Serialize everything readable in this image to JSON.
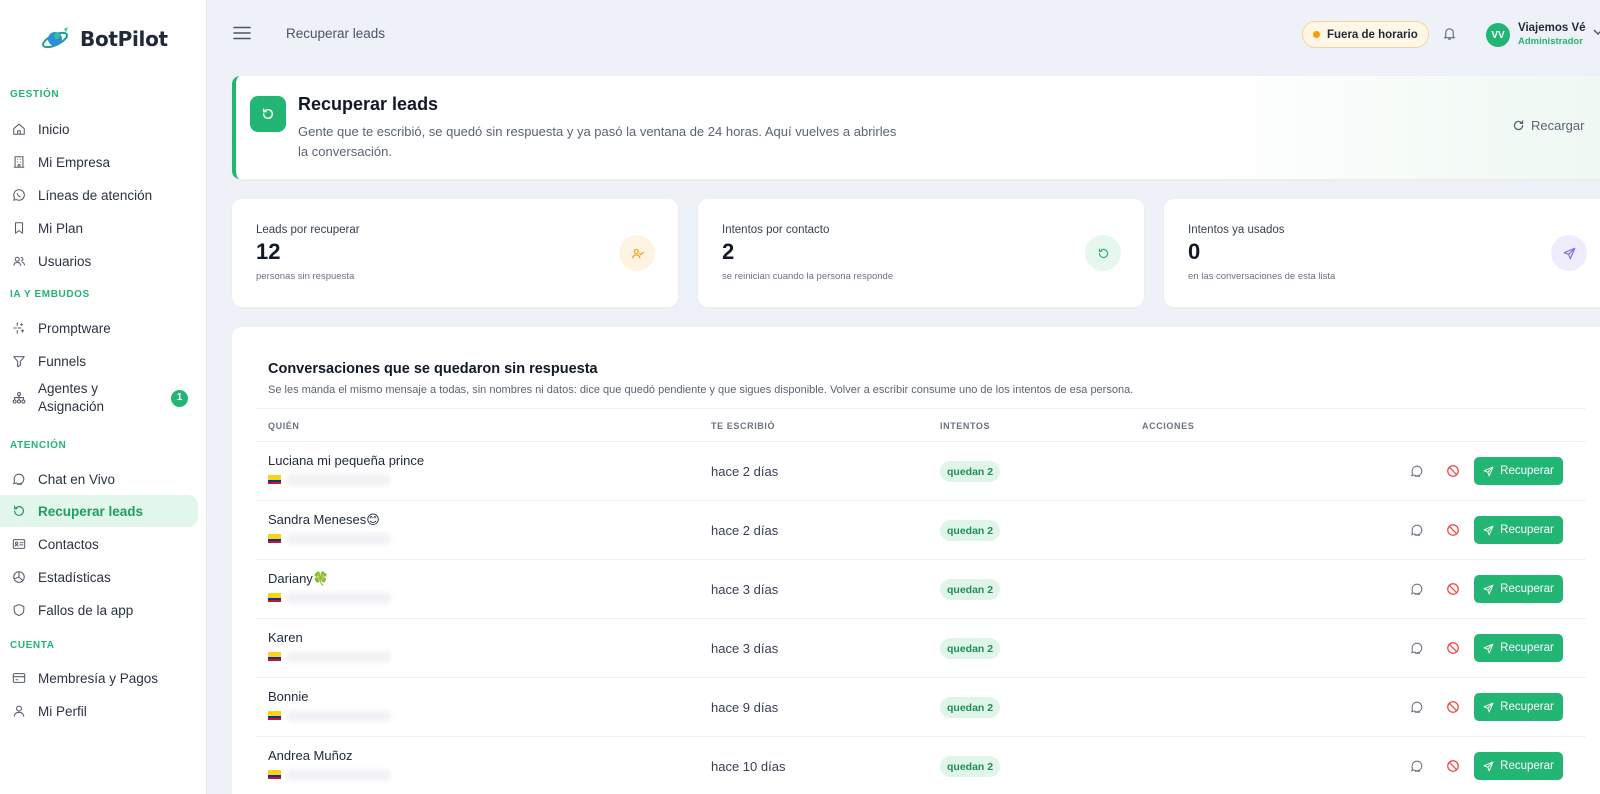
{
  "app": {
    "name": "BotPilot"
  },
  "sidebar": {
    "sections": [
      {
        "title": "GESTIÓN",
        "items": [
          {
            "label": "Inicio",
            "icon": "home-icon"
          },
          {
            "label": "Mi Empresa",
            "icon": "building-icon"
          },
          {
            "label": "Líneas de atención",
            "icon": "whatsapp-icon"
          },
          {
            "label": "Mi Plan",
            "icon": "bookmark-icon"
          },
          {
            "label": "Usuarios",
            "icon": "users-icon"
          }
        ]
      },
      {
        "title": "IA Y EMBUDOS",
        "items": [
          {
            "label": "Promptware",
            "icon": "sparkles-icon"
          },
          {
            "label": "Funnels",
            "icon": "funnel-icon"
          },
          {
            "label": "Agentes y Asignación",
            "icon": "network-icon",
            "badge": "1"
          }
        ]
      },
      {
        "title": "ATENCIÓN",
        "items": [
          {
            "label": "Chat en Vivo",
            "icon": "chat-icon"
          },
          {
            "label": "Recuperar leads",
            "icon": "refresh-icon",
            "active": true
          },
          {
            "label": "Contactos",
            "icon": "contact-card-icon"
          },
          {
            "label": "Estadísticas",
            "icon": "pie-chart-icon"
          },
          {
            "label": "Fallos de la app",
            "icon": "shield-icon"
          }
        ]
      },
      {
        "title": "CUENTA",
        "items": [
          {
            "label": "Membresía y Pagos",
            "icon": "credit-card-icon"
          },
          {
            "label": "Mi Perfil",
            "icon": "user-icon"
          }
        ]
      }
    ]
  },
  "topbar": {
    "breadcrumb": "Recuperar leads",
    "status": "Fuera de horario",
    "user": {
      "initials": "VV",
      "name": "Viajemos Vé",
      "role": "Administrador"
    }
  },
  "hero": {
    "title": "Recuperar leads",
    "description": "Gente que te escribió, se quedó sin respuesta y ya pasó la ventana de 24 horas. Aquí vuelves a abrirles la conversación.",
    "reload_label": "Recargar"
  },
  "stats": [
    {
      "label": "Leads por recuperar",
      "value": "12",
      "sub": "personas sin respuesta",
      "icon": "user-check-icon",
      "color": "#f59e0b",
      "bg": "#fff4e3"
    },
    {
      "label": "Intentos por contacto",
      "value": "2",
      "sub": "se reinician cuando la persona responde",
      "icon": "refresh-icon",
      "color": "#22b573",
      "bg": "#e6f7ee"
    },
    {
      "label": "Intentos ya usados",
      "value": "0",
      "sub": "en las conversaciones de esta lista",
      "icon": "send-icon",
      "color": "#7c6cf0",
      "bg": "#efedfd"
    }
  ],
  "table": {
    "title": "Conversaciones que se quedaron sin respuesta",
    "description": "Se les manda el mismo mensaje a todas, sin nombres ni datos: dice que quedó pendiente y que sigues disponible. Volver a escribir consume uno de los intentos de esa persona.",
    "columns": {
      "who": "QUIÉN",
      "wrote": "TE ESCRIBIÓ",
      "attempts": "INTENTOS",
      "actions": "ACCIONES"
    },
    "action_label": "Recuperar",
    "rows": [
      {
        "name": "Luciana mi pequeña prince",
        "time": "hace 2 días",
        "attempts": "quedan 2"
      },
      {
        "name": "Sandra Meneses😊",
        "time": "hace 2 días",
        "attempts": "quedan 2"
      },
      {
        "name": "Dariany🍀",
        "time": "hace 3 días",
        "attempts": "quedan 2"
      },
      {
        "name": "Karen",
        "time": "hace 3 días",
        "attempts": "quedan 2"
      },
      {
        "name": "Bonnie",
        "time": "hace 9 días",
        "attempts": "quedan 2"
      },
      {
        "name": "Andrea Muñoz",
        "time": "hace 10 días",
        "attempts": "quedan 2"
      }
    ]
  }
}
